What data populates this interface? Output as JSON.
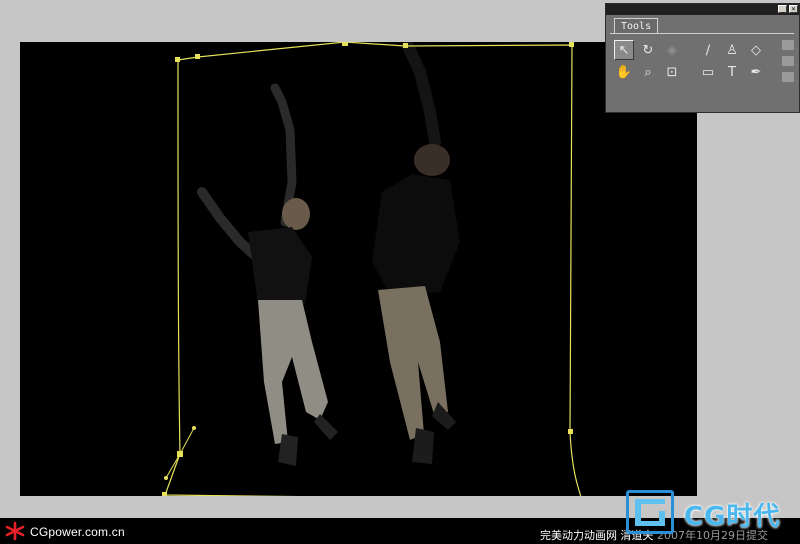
{
  "tools_panel": {
    "tab_label": "Tools",
    "tools": [
      {
        "name": "selection-tool-icon",
        "glyph": "↖",
        "active": true
      },
      {
        "name": "rotation-tool-icon",
        "glyph": "↻"
      },
      {
        "name": "camera-tool-icon",
        "glyph": "◈",
        "dim": true
      },
      {
        "name": "brush-tool-icon",
        "glyph": "∕"
      },
      {
        "name": "clone-stamp-tool-icon",
        "glyph": "♙"
      },
      {
        "name": "eraser-tool-icon",
        "glyph": "◇"
      },
      {
        "name": "hand-tool-icon",
        "glyph": "✋"
      },
      {
        "name": "zoom-tool-icon",
        "glyph": "⌕"
      },
      {
        "name": "pan-behind-tool-icon",
        "glyph": "⊡"
      },
      {
        "name": "rectangle-mask-tool-icon",
        "glyph": "▭"
      },
      {
        "name": "type-tool-icon",
        "glyph": "T"
      },
      {
        "name": "pen-tool-icon",
        "glyph": "✒"
      }
    ]
  },
  "footer": {
    "site_name": "CGpower.com.cn",
    "credit_site": "完美动力动画网",
    "credit_author": "清道夫",
    "credit_date": "2007年10月29日提交"
  },
  "watermark": {
    "text": "CG时代"
  },
  "colors": {
    "mask_path": "#e6e05a",
    "footer_bg": "#000000",
    "watermark_blue": "#4ab8ee"
  }
}
